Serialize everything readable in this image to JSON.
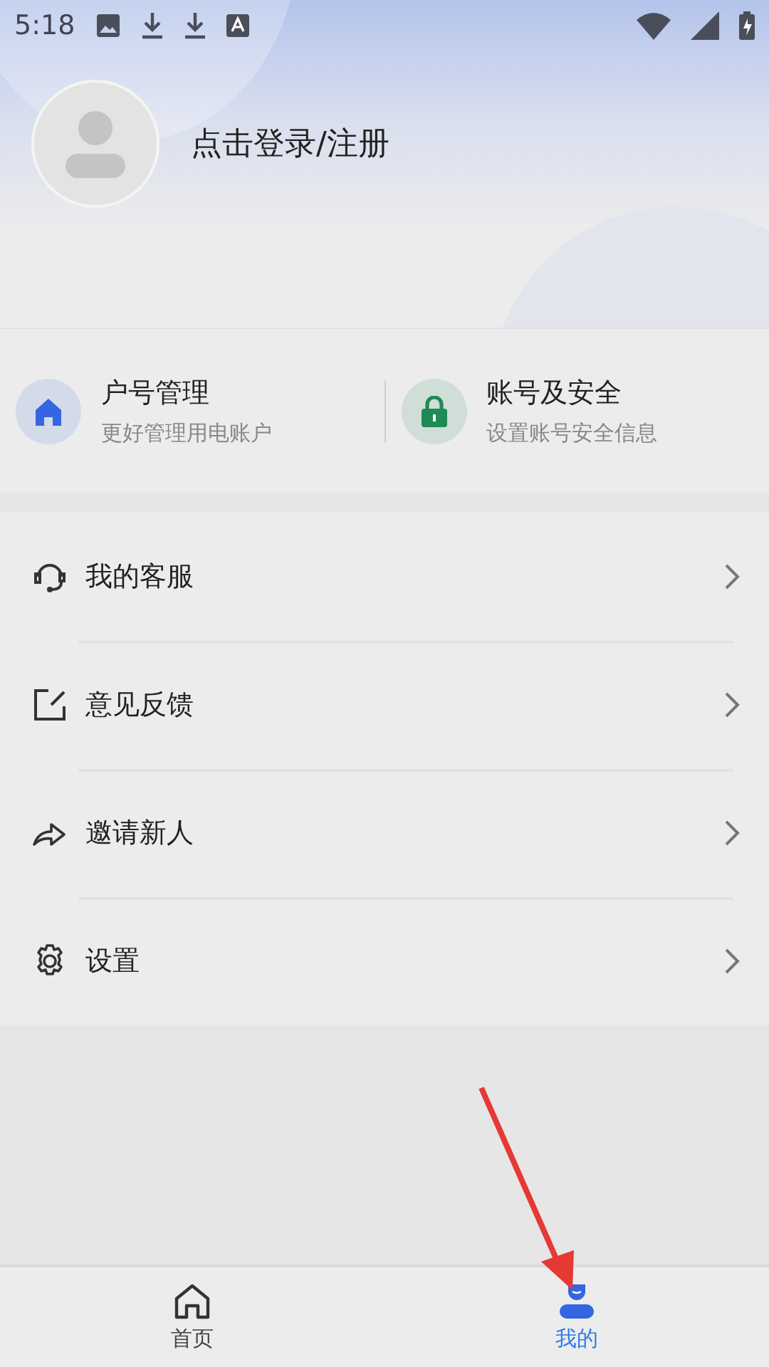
{
  "status_bar": {
    "time": "5:18"
  },
  "profile": {
    "login_prompt": "点击登录/注册"
  },
  "quick_cards": [
    {
      "title": "户号管理",
      "subtitle": "更好管理用电账户",
      "color": "#3366e0"
    },
    {
      "title": "账号及安全",
      "subtitle": "设置账号安全信息",
      "color": "#1e8a55"
    }
  ],
  "menu": [
    {
      "label": "我的客服"
    },
    {
      "label": "意见反馈"
    },
    {
      "label": "邀请新人"
    },
    {
      "label": "设置"
    }
  ],
  "tabs": [
    {
      "label": "首页",
      "selected": false
    },
    {
      "label": "我的",
      "selected": true
    }
  ]
}
